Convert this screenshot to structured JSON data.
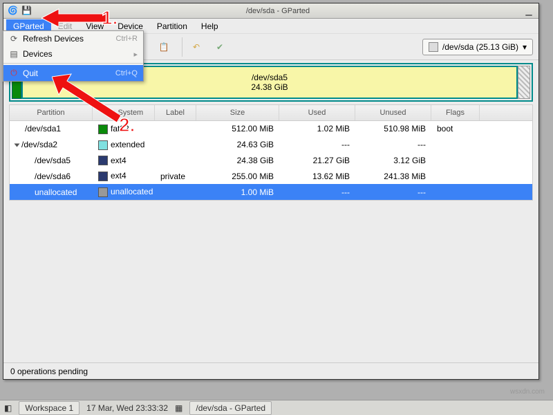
{
  "window": {
    "title": "/dev/sda - GParted"
  },
  "menubar": [
    "GParted",
    "Edit",
    "View",
    "Device",
    "Partition",
    "Help"
  ],
  "dropdown": {
    "refresh": {
      "label": "Refresh Devices",
      "shortcut": "Ctrl+R"
    },
    "devices": {
      "label": "Devices"
    },
    "quit": {
      "label": "Quit",
      "shortcut": "Ctrl+Q"
    }
  },
  "device_selector": "/dev/sda  (25.13 GiB)",
  "disk_graphic": {
    "name": "/dev/sda5",
    "size": "24.38 GiB"
  },
  "columns": {
    "partition": "Partition",
    "fs": "File System",
    "label": "Label",
    "size": "Size",
    "used": "Used",
    "unused": "Unused",
    "flags": "Flags"
  },
  "rows": [
    {
      "partition": "/dev/sda1",
      "color": "#0a8a0a",
      "fs": "fat32",
      "label": "",
      "size": "512.00 MiB",
      "used": "1.02 MiB",
      "unused": "510.98 MiB",
      "flags": "boot",
      "indent": 1,
      "selected": false
    },
    {
      "partition": "/dev/sda2",
      "color": "#7fe0e0",
      "fs": "extended",
      "label": "",
      "size": "24.63 GiB",
      "used": "---",
      "unused": "---",
      "flags": "",
      "indent": 0,
      "expand": true,
      "selected": false
    },
    {
      "partition": "/dev/sda5",
      "color": "#2b3a6f",
      "fs": "ext4",
      "label": "",
      "size": "24.38 GiB",
      "used": "21.27 GiB",
      "unused": "3.12 GiB",
      "flags": "",
      "indent": 2,
      "selected": false
    },
    {
      "partition": "/dev/sda6",
      "color": "#2b3a6f",
      "fs": "ext4",
      "label": "private",
      "size": "255.00 MiB",
      "used": "13.62 MiB",
      "unused": "241.38 MiB",
      "flags": "",
      "indent": 2,
      "selected": false
    },
    {
      "partition": "unallocated",
      "color": "#999999",
      "fs": "unallocated",
      "label": "",
      "size": "1.00 MiB",
      "used": "---",
      "unused": "---",
      "flags": "",
      "indent": 2,
      "selected": true
    }
  ],
  "status": "0 operations pending",
  "taskbar": {
    "workspace": "Workspace 1",
    "clock": "17 Mar, Wed 23:33:32",
    "task": "/dev/sda - GParted"
  },
  "annotations": {
    "one": "1.",
    "two": "2."
  },
  "watermark": "wsxdn.com"
}
